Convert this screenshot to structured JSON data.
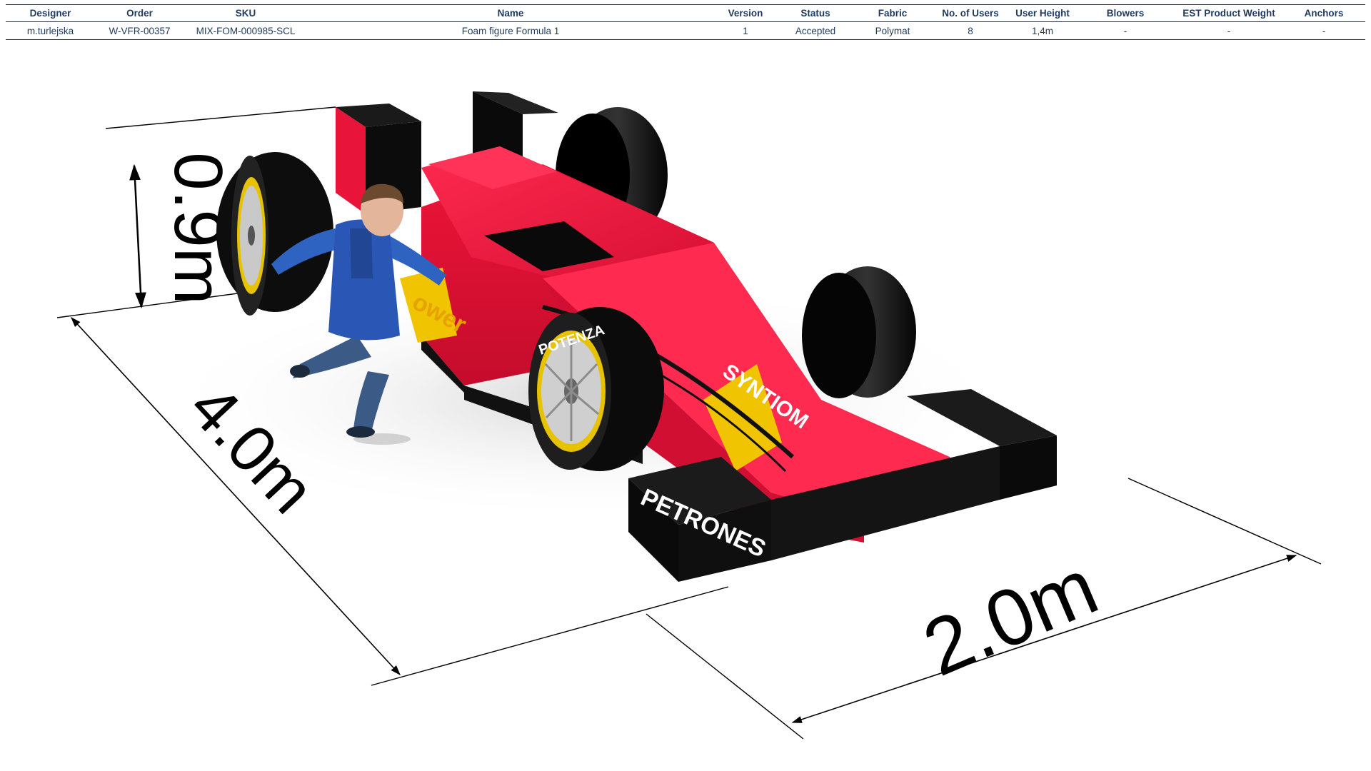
{
  "spec_table": {
    "headers": [
      "Designer",
      "Order",
      "SKU",
      "Name",
      "Version",
      "Status",
      "Fabric",
      "No. of Users",
      "User  Height",
      "Blowers",
      "EST Product Weight",
      "Anchors"
    ],
    "row": [
      "m.turlejska",
      "W-VFR-00357",
      "MIX-FOM-000985-SCL",
      "Foam figure Formula 1",
      "1",
      "Accepted",
      "Polymat",
      "8",
      "1,4m",
      "-",
      "-",
      "-"
    ]
  },
  "render": {
    "dimensions": {
      "height": "0.9m",
      "length": "4.0m",
      "width": "2.0m"
    },
    "decals": {
      "side_logo": "SYNTIOM",
      "front_wing": "PETRONES",
      "tire": "POTENZA",
      "nose_partial": "ower"
    },
    "colors": {
      "body": "#e8143a",
      "accent": "#f0c400",
      "tire": "#0a0a0a",
      "rim": "#c9c9c9",
      "rim_band": "#e6c200"
    }
  }
}
